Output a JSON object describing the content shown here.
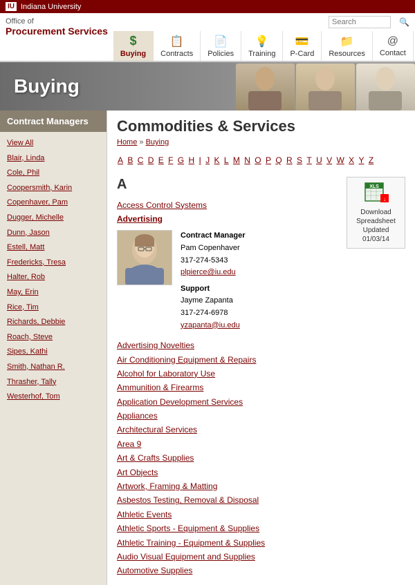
{
  "topbar": {
    "university": "Indiana University"
  },
  "header": {
    "logo": {
      "office_of": "Office of",
      "proc_services": "Procurement Services"
    },
    "nav": {
      "items": [
        {
          "label": "Buying",
          "icon": "$",
          "icon_class": "dollar",
          "active": true
        },
        {
          "label": "Contracts",
          "icon": "📋",
          "icon_class": "contract",
          "active": false
        },
        {
          "label": "Policies",
          "icon": "📋",
          "icon_class": "policy",
          "active": false
        },
        {
          "label": "Training",
          "icon": "💡",
          "icon_class": "training",
          "active": false
        },
        {
          "label": "P-Card",
          "icon": "💳",
          "icon_class": "pcard",
          "active": false
        },
        {
          "label": "Resources",
          "icon": "📁",
          "icon_class": "resources",
          "active": false
        },
        {
          "label": "Contact",
          "icon": "@",
          "icon_class": "contact",
          "active": false
        }
      ],
      "search_placeholder": "Search"
    }
  },
  "banner": {
    "title": "Buying"
  },
  "sidebar": {
    "title": "Contract Managers",
    "links": [
      {
        "label": "View All"
      },
      {
        "label": "Blair, Linda"
      },
      {
        "label": "Cole, Phil"
      },
      {
        "label": "Coopersmith, Karin"
      },
      {
        "label": "Copenhaver, Pam"
      },
      {
        "label": "Dugger, Michelle"
      },
      {
        "label": "Dunn, Jason"
      },
      {
        "label": "Estell, Matt"
      },
      {
        "label": "Fredericks, Tresa"
      },
      {
        "label": "Halter, Rob"
      },
      {
        "label": "May, Erin"
      },
      {
        "label": "Rice, Tim"
      },
      {
        "label": "Richards, Debbie"
      },
      {
        "label": "Roach, Steve"
      },
      {
        "label": "Sipes, Kathi"
      },
      {
        "label": "Smith, Nathan R."
      },
      {
        "label": "Thrasher, Tally"
      },
      {
        "label": "Westerhof, Tom"
      }
    ]
  },
  "content": {
    "page_title": "Commodities & Services",
    "breadcrumb": {
      "home": "Home",
      "buying": "Buying"
    },
    "alphabet": [
      "A",
      "B",
      "C",
      "D",
      "E",
      "F",
      "G",
      "H",
      "I",
      "J",
      "K",
      "L",
      "M",
      "N",
      "O",
      "P",
      "Q",
      "R",
      "S",
      "T",
      "U",
      "V",
      "W",
      "X",
      "Y",
      "Z"
    ],
    "download": {
      "text": "Download Spreadsheet Updated 01/03/14",
      "icon": "XLS"
    },
    "section_a": {
      "letter": "A",
      "items": [
        {
          "label": "Access Control Systems"
        },
        {
          "label": "Advertising"
        },
        {
          "label": "Advertising Novelties"
        },
        {
          "label": "Air Conditioning Equipment & Repairs"
        },
        {
          "label": "Alcohol for Laboratory Use"
        },
        {
          "label": "Ammunition & Firearms"
        },
        {
          "label": "Application Development Services"
        },
        {
          "label": "Appliances"
        },
        {
          "label": "Architectural Services"
        },
        {
          "label": "Area 9"
        },
        {
          "label": "Art & Crafts Supplies"
        },
        {
          "label": "Art Objects"
        },
        {
          "label": "Artwork, Framing & Matting"
        },
        {
          "label": "Asbestos Testing, Removal & Disposal"
        },
        {
          "label": "Athletic Events"
        },
        {
          "label": "Athletic Sports - Equipment & Supplies"
        },
        {
          "label": "Athletic Training - Equipment & Supplies"
        },
        {
          "label": "Audio Visual Equipment and Supplies"
        },
        {
          "label": "Automotive Supplies"
        }
      ]
    },
    "advertising_detail": {
      "manager_label": "Contract Manager",
      "manager_name": "Pam Copenhaver",
      "manager_phone": "317-274-5343",
      "manager_email": "plpierce@iu.edu",
      "support_label": "Support",
      "support_name": "Jayme Zapanta",
      "support_phone": "317-274-6978",
      "support_email": "yzapanta@iu.edu"
    }
  }
}
